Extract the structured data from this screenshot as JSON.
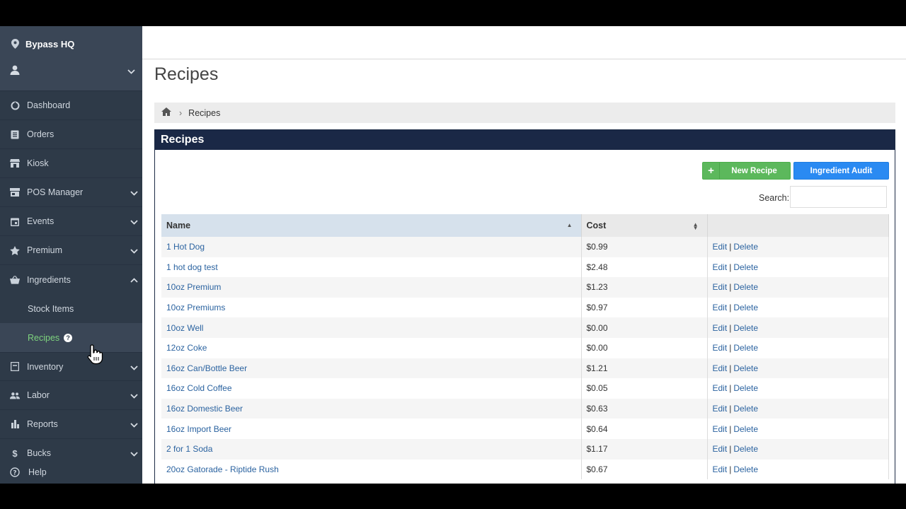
{
  "sidebar": {
    "location": "Bypass HQ",
    "items": [
      {
        "label": "Dashboard",
        "icon": "dashboard-icon"
      },
      {
        "label": "Orders",
        "icon": "orders-icon"
      },
      {
        "label": "Kiosk",
        "icon": "kiosk-icon"
      },
      {
        "label": "POS Manager",
        "icon": "pos-icon"
      },
      {
        "label": "Events",
        "icon": "calendar-icon"
      },
      {
        "label": "Premium",
        "icon": "star-icon"
      },
      {
        "label": "Ingredients",
        "icon": "basket-icon"
      }
    ],
    "sub_items": [
      {
        "label": "Stock Items"
      },
      {
        "label": "Recipes"
      }
    ],
    "items_after": [
      {
        "label": "Inventory",
        "icon": "inventory-icon"
      },
      {
        "label": "Labor",
        "icon": "people-icon"
      },
      {
        "label": "Reports",
        "icon": "bar-chart-icon"
      },
      {
        "label": "Bucks",
        "icon": "dollar-icon"
      }
    ],
    "help": "Help"
  },
  "page": {
    "title": "Recipes",
    "breadcrumb": "Recipes",
    "panel_title": "Recipes",
    "new_button": "New Recipe",
    "audit_button": "Ingredient Audit",
    "search_label": "Search:",
    "search_value": ""
  },
  "table": {
    "headers": [
      "Name",
      "Cost",
      ""
    ],
    "action_edit": "Edit",
    "action_sep": "|",
    "action_delete": "Delete",
    "rows": [
      {
        "name": "1 Hot Dog",
        "cost": "$0.99"
      },
      {
        "name": "1 hot dog test",
        "cost": "$2.48"
      },
      {
        "name": "10oz Premium",
        "cost": "$1.23"
      },
      {
        "name": "10oz Premiums",
        "cost": "$0.97"
      },
      {
        "name": "10oz Well",
        "cost": "$0.00"
      },
      {
        "name": "12oz Coke",
        "cost": "$0.00"
      },
      {
        "name": "16oz Can/Bottle Beer",
        "cost": "$1.21"
      },
      {
        "name": "16oz Cold Coffee",
        "cost": "$0.05"
      },
      {
        "name": "16oz Domestic Beer",
        "cost": "$0.63"
      },
      {
        "name": "16oz Import Beer",
        "cost": "$0.64"
      },
      {
        "name": "2 for 1 Soda",
        "cost": "$1.17"
      },
      {
        "name": "20oz Gatorade - Riptide Rush",
        "cost": "$0.67"
      }
    ]
  },
  "colors": {
    "sidebar_bg": "#2e3a48",
    "active_green": "#7ed47e",
    "panel_header": "#1a2846",
    "new_button": "#5cb85c",
    "audit_button": "#2a8af2",
    "link": "#2b63a0"
  }
}
